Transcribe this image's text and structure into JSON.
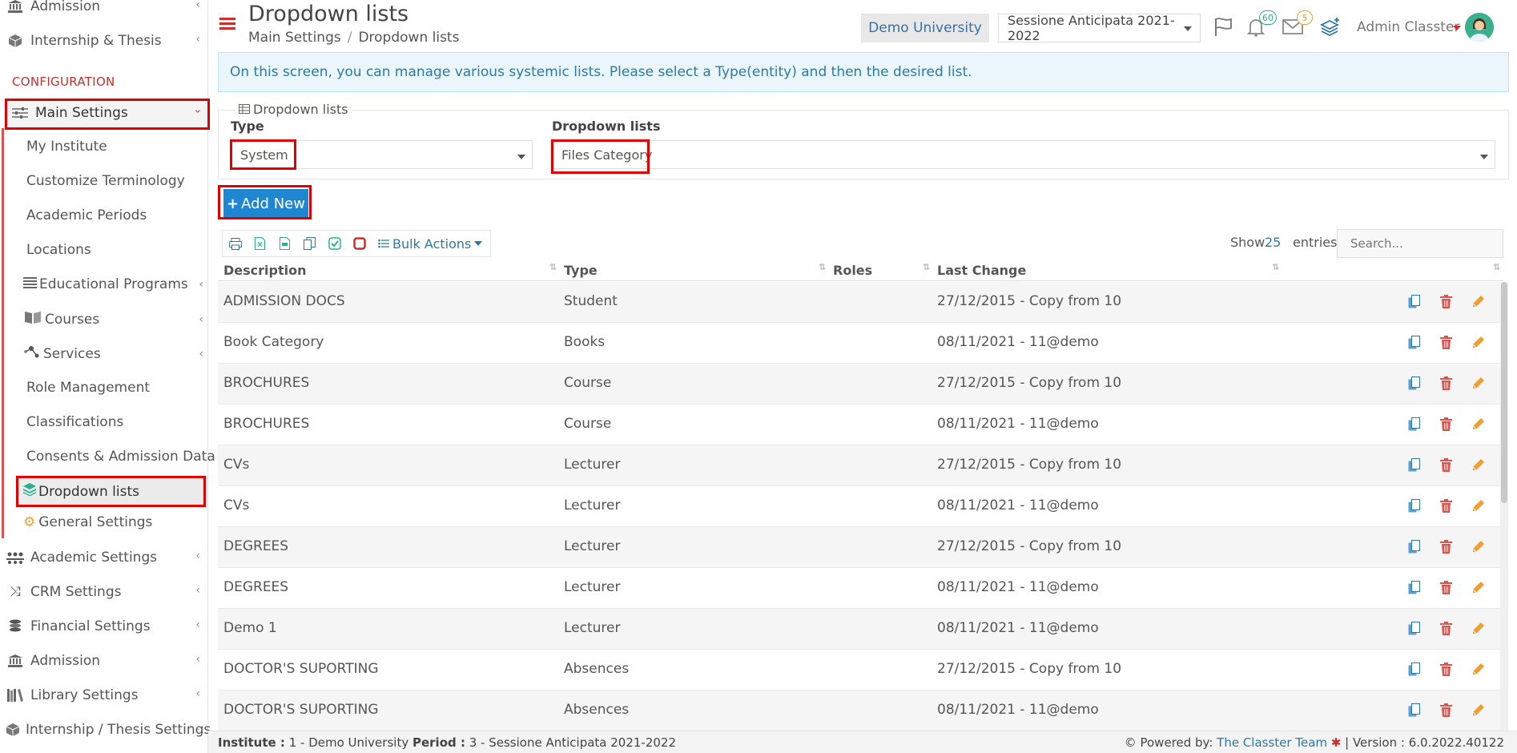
{
  "sidebar": {
    "top_items": [
      {
        "label": "Admission",
        "icon": "institution-icon"
      },
      {
        "label": "Internship & Thesis",
        "icon": "box-icon"
      }
    ],
    "section_label": "CONFIGURATION",
    "main_settings": {
      "label": "Main Settings",
      "icon": "sliders-icon"
    },
    "sub_items": [
      {
        "label": "My Institute"
      },
      {
        "label": "Customize Terminology"
      },
      {
        "label": "Academic Periods"
      },
      {
        "label": "Locations"
      },
      {
        "label": "Educational Programs",
        "icon": "list-icon"
      },
      {
        "label": "Courses",
        "icon": "book-icon"
      },
      {
        "label": "Services",
        "icon": "network-icon"
      },
      {
        "label": "Role Management"
      },
      {
        "label": "Classifications"
      },
      {
        "label": "Consents & Admission Data"
      },
      {
        "label": "Dropdown lists",
        "icon": "layers-icon"
      },
      {
        "label": "General Settings",
        "icon": "gears-icon"
      }
    ],
    "bottom_items": [
      {
        "label": "Academic Settings",
        "icon": "users-icon"
      },
      {
        "label": "CRM Settings",
        "icon": "shuffle-icon"
      },
      {
        "label": "Financial Settings",
        "icon": "coins-icon"
      },
      {
        "label": "Admission",
        "icon": "institution-icon"
      },
      {
        "label": "Library Settings",
        "icon": "books-icon"
      },
      {
        "label": "Internship / Thesis Settings",
        "icon": "box-icon"
      }
    ]
  },
  "header": {
    "title": "Dropdown lists",
    "breadcrumb": [
      "Main Settings",
      "Dropdown lists"
    ],
    "university": "Demo University",
    "period": "Sessione Anticipata 2021-2022",
    "notifications_count": "60",
    "messages_count": "5",
    "user_name": "Admin Classter"
  },
  "info": "On this screen, you can manage various systemic lists. Please select a Type(entity) and then the desired list.",
  "filter": {
    "legend": "Dropdown lists",
    "type_label": "Type",
    "type_value": "System",
    "list_label": "Dropdown lists",
    "list_value": "Files Category"
  },
  "add_new_label": "Add New",
  "toolbar": {
    "bulk_actions": "Bulk Actions",
    "show_label": "Show",
    "show_count": "25",
    "entries_label": "entries",
    "search_placeholder": "Search..."
  },
  "table": {
    "columns": [
      "Description",
      "Type",
      "Roles",
      "Last Change"
    ],
    "rows": [
      {
        "description": "ADMISSION DOCS",
        "type": "Student",
        "roles": "",
        "last_change": "27/12/2015 - Copy from 10"
      },
      {
        "description": "Book Category",
        "type": "Books",
        "roles": "",
        "last_change": "08/11/2021 - 11@demo"
      },
      {
        "description": "BROCHURES",
        "type": "Course",
        "roles": "",
        "last_change": "27/12/2015 - Copy from 10"
      },
      {
        "description": "BROCHURES",
        "type": "Course",
        "roles": "",
        "last_change": "08/11/2021 - 11@demo"
      },
      {
        "description": "CVs",
        "type": "Lecturer",
        "roles": "",
        "last_change": "27/12/2015 - Copy from 10"
      },
      {
        "description": "CVs",
        "type": "Lecturer",
        "roles": "",
        "last_change": "08/11/2021 - 11@demo"
      },
      {
        "description": "DEGREES",
        "type": "Lecturer",
        "roles": "",
        "last_change": "27/12/2015 - Copy from 10"
      },
      {
        "description": "DEGREES",
        "type": "Lecturer",
        "roles": "",
        "last_change": "08/11/2021 - 11@demo"
      },
      {
        "description": "Demo 1",
        "type": "Lecturer",
        "roles": "",
        "last_change": "08/11/2021 - 11@demo"
      },
      {
        "description": "DOCTOR'S SUPORTING",
        "type": "Absences",
        "roles": "",
        "last_change": "27/12/2015 - Copy from 10"
      },
      {
        "description": "DOCTOR'S SUPORTING",
        "type": "Absences",
        "roles": "",
        "last_change": "08/11/2021 - 11@demo"
      }
    ]
  },
  "footer": {
    "institute_label": "Institute :",
    "institute_value": "1 - Demo University",
    "period_label": "Period :",
    "period_value": "3 - Sessione Anticipata 2021-2022",
    "powered_label": "Powered by:",
    "powered_link": "The Classter Team",
    "version": "| Version : 6.0.2022.40122"
  },
  "colors": {
    "accent": "#1f86d2",
    "highlight": "#e00000",
    "brand_red": "#c9302c"
  }
}
